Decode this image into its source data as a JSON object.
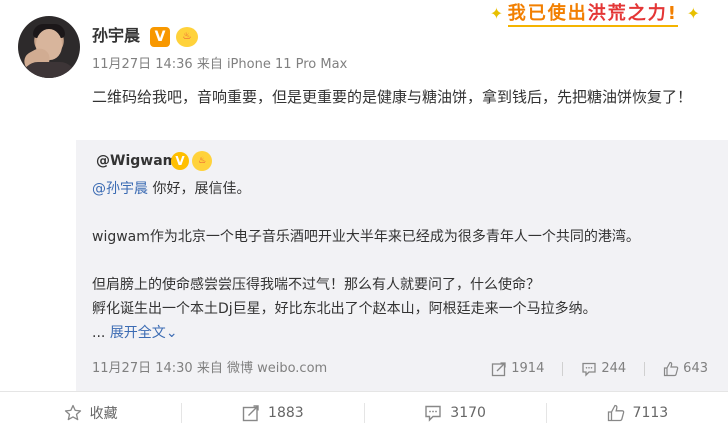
{
  "post": {
    "username": "孙宇晨",
    "verified_glyph": "V",
    "badge_glyph": "♨",
    "meta": "11月27日 14:36 来自 iPhone 11 Pro Max",
    "text": "二维码给我吧，音响重要，但是更重要的是健康与糖油饼，拿到钱后，先把糖油饼恢复了！"
  },
  "banner": {
    "part1": "我已使出",
    "part2": "洪荒之力",
    "part3": "!",
    "spark_left": "✦",
    "spark_right": "✦"
  },
  "repost": {
    "username": "@Wigwam",
    "vip_glyph": "V",
    "badge_glyph": "♨",
    "mention": "@孙宇晨",
    "greeting": " 你好，展信佳。",
    "line2": "wigwam作为北京一个电子音乐酒吧开业大半年来已经成为很多青年人一个共同的港湾。",
    "line3": "但肩膀上的使命感尝尝压得我喘不过气！那么有人就要问了，什么使命？",
    "line4": "孵化诞生出一个本土Dj巨星，好比东北出了个赵本山，阿根廷走来一个马拉多纳。",
    "ellipsis": "... ",
    "expand_label": "展开全文",
    "expand_arrow": "⌄",
    "meta": "11月27日 14:30 来自 微博 weibo.com",
    "stats": {
      "repost_count": "1914",
      "comment_count": "244",
      "like_count": "643"
    }
  },
  "actions": {
    "favorite_label": "收藏",
    "repost_count": "1883",
    "comment_count": "3170",
    "like_count": "7113"
  },
  "colors": {
    "link": "#3b6bb3",
    "repost_bg": "#f2f2f5",
    "verified": "#f89800",
    "banner_orange": "#f27f00",
    "banner_red": "#e43636"
  }
}
